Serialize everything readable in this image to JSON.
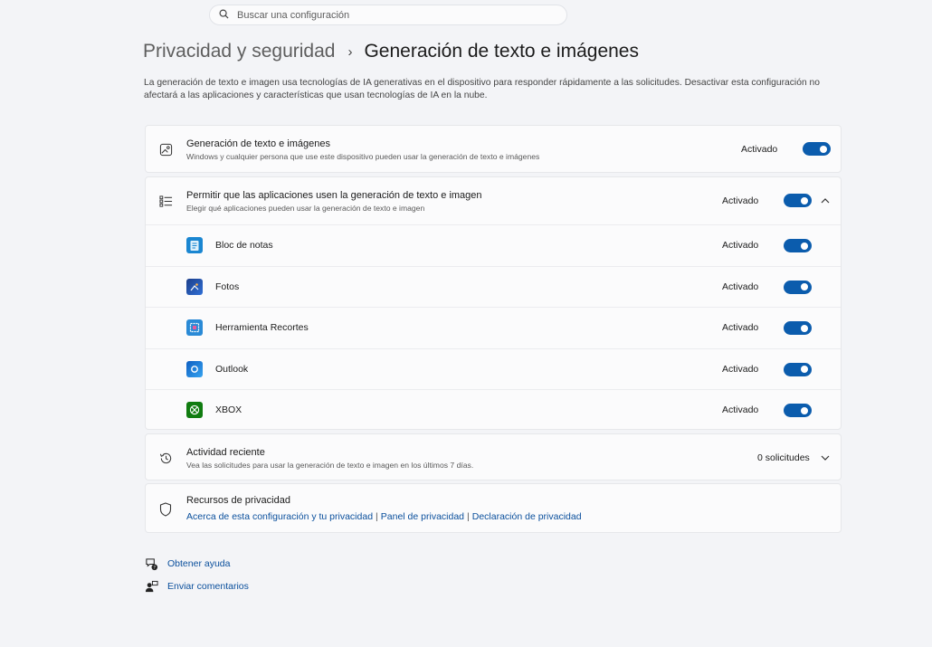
{
  "search": {
    "placeholder": "Buscar una configuración"
  },
  "breadcrumb": {
    "parent": "Privacidad y seguridad",
    "separator": "›",
    "current": "Generación de texto e imágenes"
  },
  "description": "La generación de texto e imagen usa tecnologías de IA generativas en el dispositivo para responder rápidamente a las solicitudes. Desactivar esta configuración no afectará a las aplicaciones y características que usan tecnologías de IA en la nube.",
  "main_setting": {
    "title": "Generación de texto e imágenes",
    "subtitle": "Windows y cualquier persona que use este dispositivo pueden usar la generación de texto e imágenes",
    "status": "Activado",
    "on": true
  },
  "apps_setting": {
    "title": "Permitir que las aplicaciones usen la generación de texto e imagen",
    "subtitle": "Elegir qué aplicaciones pueden usar la generación de texto e imagen",
    "status": "Activado",
    "on": true,
    "apps": [
      {
        "name": "Bloc de notas",
        "status": "Activado",
        "on": true,
        "icon": "notepad-icon"
      },
      {
        "name": "Fotos",
        "status": "Activado",
        "on": true,
        "icon": "photos-icon"
      },
      {
        "name": "Herramienta Recortes",
        "status": "Activado",
        "on": true,
        "icon": "snipping-tool-icon"
      },
      {
        "name": "Outlook",
        "status": "Activado",
        "on": true,
        "icon": "outlook-icon"
      },
      {
        "name": "XBOX",
        "status": "Activado",
        "on": true,
        "icon": "xbox-icon"
      }
    ]
  },
  "recent_activity": {
    "title": "Actividad reciente",
    "subtitle": "Vea las solicitudes para usar la generación de texto e imagen en los últimos 7 días.",
    "count": "0 solicitudes"
  },
  "privacy_resources": {
    "title": "Recursos de privacidad",
    "links": [
      "Acerca de esta configuración y tu privacidad",
      "Panel de privacidad",
      "Declaración de privacidad"
    ]
  },
  "help": {
    "get_help": "Obtener ayuda",
    "feedback": "Enviar comentarios"
  },
  "colors": {
    "accent": "#0b5cad",
    "link": "#0a4f9c",
    "background": "#f3f4f7",
    "card": "#fbfbfc"
  }
}
